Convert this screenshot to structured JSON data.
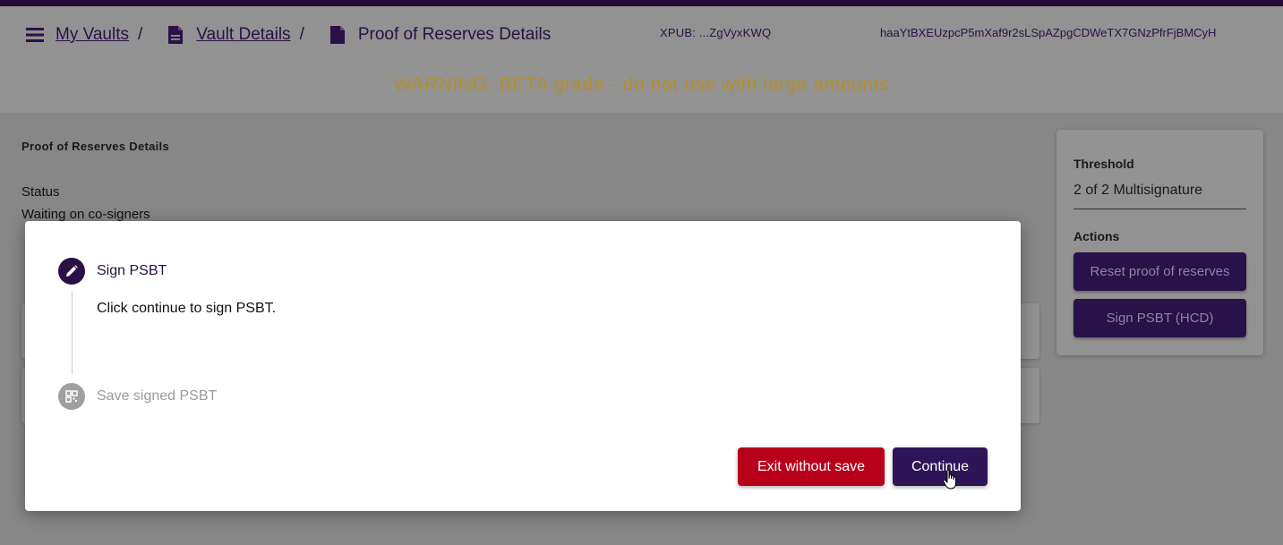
{
  "header": {
    "breadcrumbs": [
      {
        "label": "My Vaults",
        "icon": "list-icon"
      },
      {
        "label": "Vault Details",
        "icon": "document-icon"
      },
      {
        "label": "Proof of Reserves Details",
        "icon": "document-icon"
      }
    ],
    "separator": "/",
    "xpub": "XPUB: ...ZgVyxKWQ",
    "hash": "haaYtBXEUzpcP5mXaf9r2sLSpAZpgCDWeTX7GNzPfrFjBMCyH",
    "warning": "WARNING: BETA grade - do not use with large amounts"
  },
  "page": {
    "section_title": "Proof of Reserves Details",
    "status_label": "Status",
    "status_value": "Waiting on co-signers"
  },
  "sidebar": {
    "threshold_label": "Threshold",
    "threshold_value": "2 of 2 Multisignature",
    "actions_label": "Actions",
    "reset_button": "Reset proof of reserves",
    "sign_button": "Sign PSBT (HCD)"
  },
  "modal": {
    "steps": [
      {
        "title": "Sign PSBT",
        "icon": "pencil-icon",
        "state": "active"
      },
      {
        "title": "Save signed PSBT",
        "icon": "qr-code-icon",
        "state": "inactive"
      }
    ],
    "step_content": "Click continue to sign PSBT.",
    "exit_button": "Exit without save",
    "continue_button": "Continue"
  },
  "colors": {
    "brand_purple": "#2e1558",
    "danger_red": "#b8001a",
    "warning_gold": "#b38d2a",
    "overlay_gray": "#878787"
  }
}
